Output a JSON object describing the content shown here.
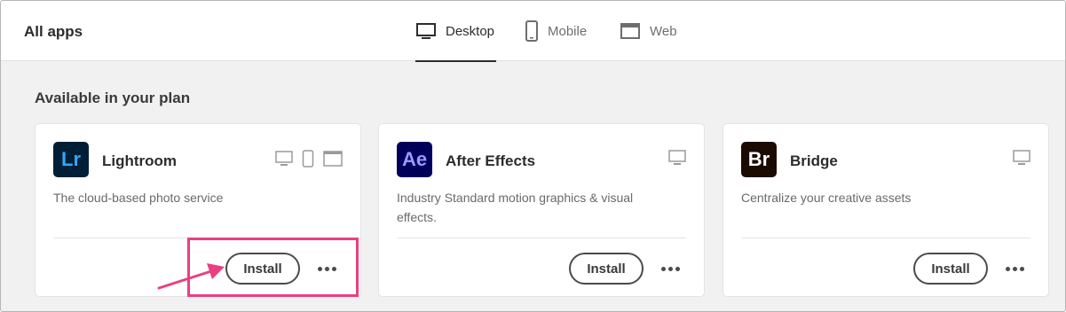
{
  "header": {
    "title": "All apps",
    "tabs": [
      {
        "label": "Desktop",
        "icon": "desktop-icon",
        "active": true
      },
      {
        "label": "Mobile",
        "icon": "mobile-icon",
        "active": false
      },
      {
        "label": "Web",
        "icon": "web-icon",
        "active": false
      }
    ]
  },
  "section": {
    "title": "Available in your plan"
  },
  "apps": [
    {
      "icon_text": "Lr",
      "icon_bg": "#001e36",
      "icon_fg": "#31a8ff",
      "name": "Lightroom",
      "description": "The cloud-based photo service",
      "platforms": [
        "desktop-icon",
        "mobile-icon",
        "web-icon"
      ],
      "install_label": "Install",
      "more_label": "•••"
    },
    {
      "icon_text": "Ae",
      "icon_bg": "#00005b",
      "icon_fg": "#9999ff",
      "name": "After Effects",
      "description": "Industry Standard motion graphics & visual effects.",
      "platforms": [
        "desktop-icon"
      ],
      "install_label": "Install",
      "more_label": "•••"
    },
    {
      "icon_text": "Br",
      "icon_bg": "#1a0a00",
      "icon_fg": "#ffffff",
      "name": "Bridge",
      "description": "Centralize your creative assets",
      "platforms": [
        "desktop-icon"
      ],
      "install_label": "Install",
      "more_label": "•••"
    }
  ],
  "colors": {
    "annotation": "#ea3f82",
    "text_primary": "#2c2c2c",
    "text_secondary": "#6a6a6a"
  }
}
